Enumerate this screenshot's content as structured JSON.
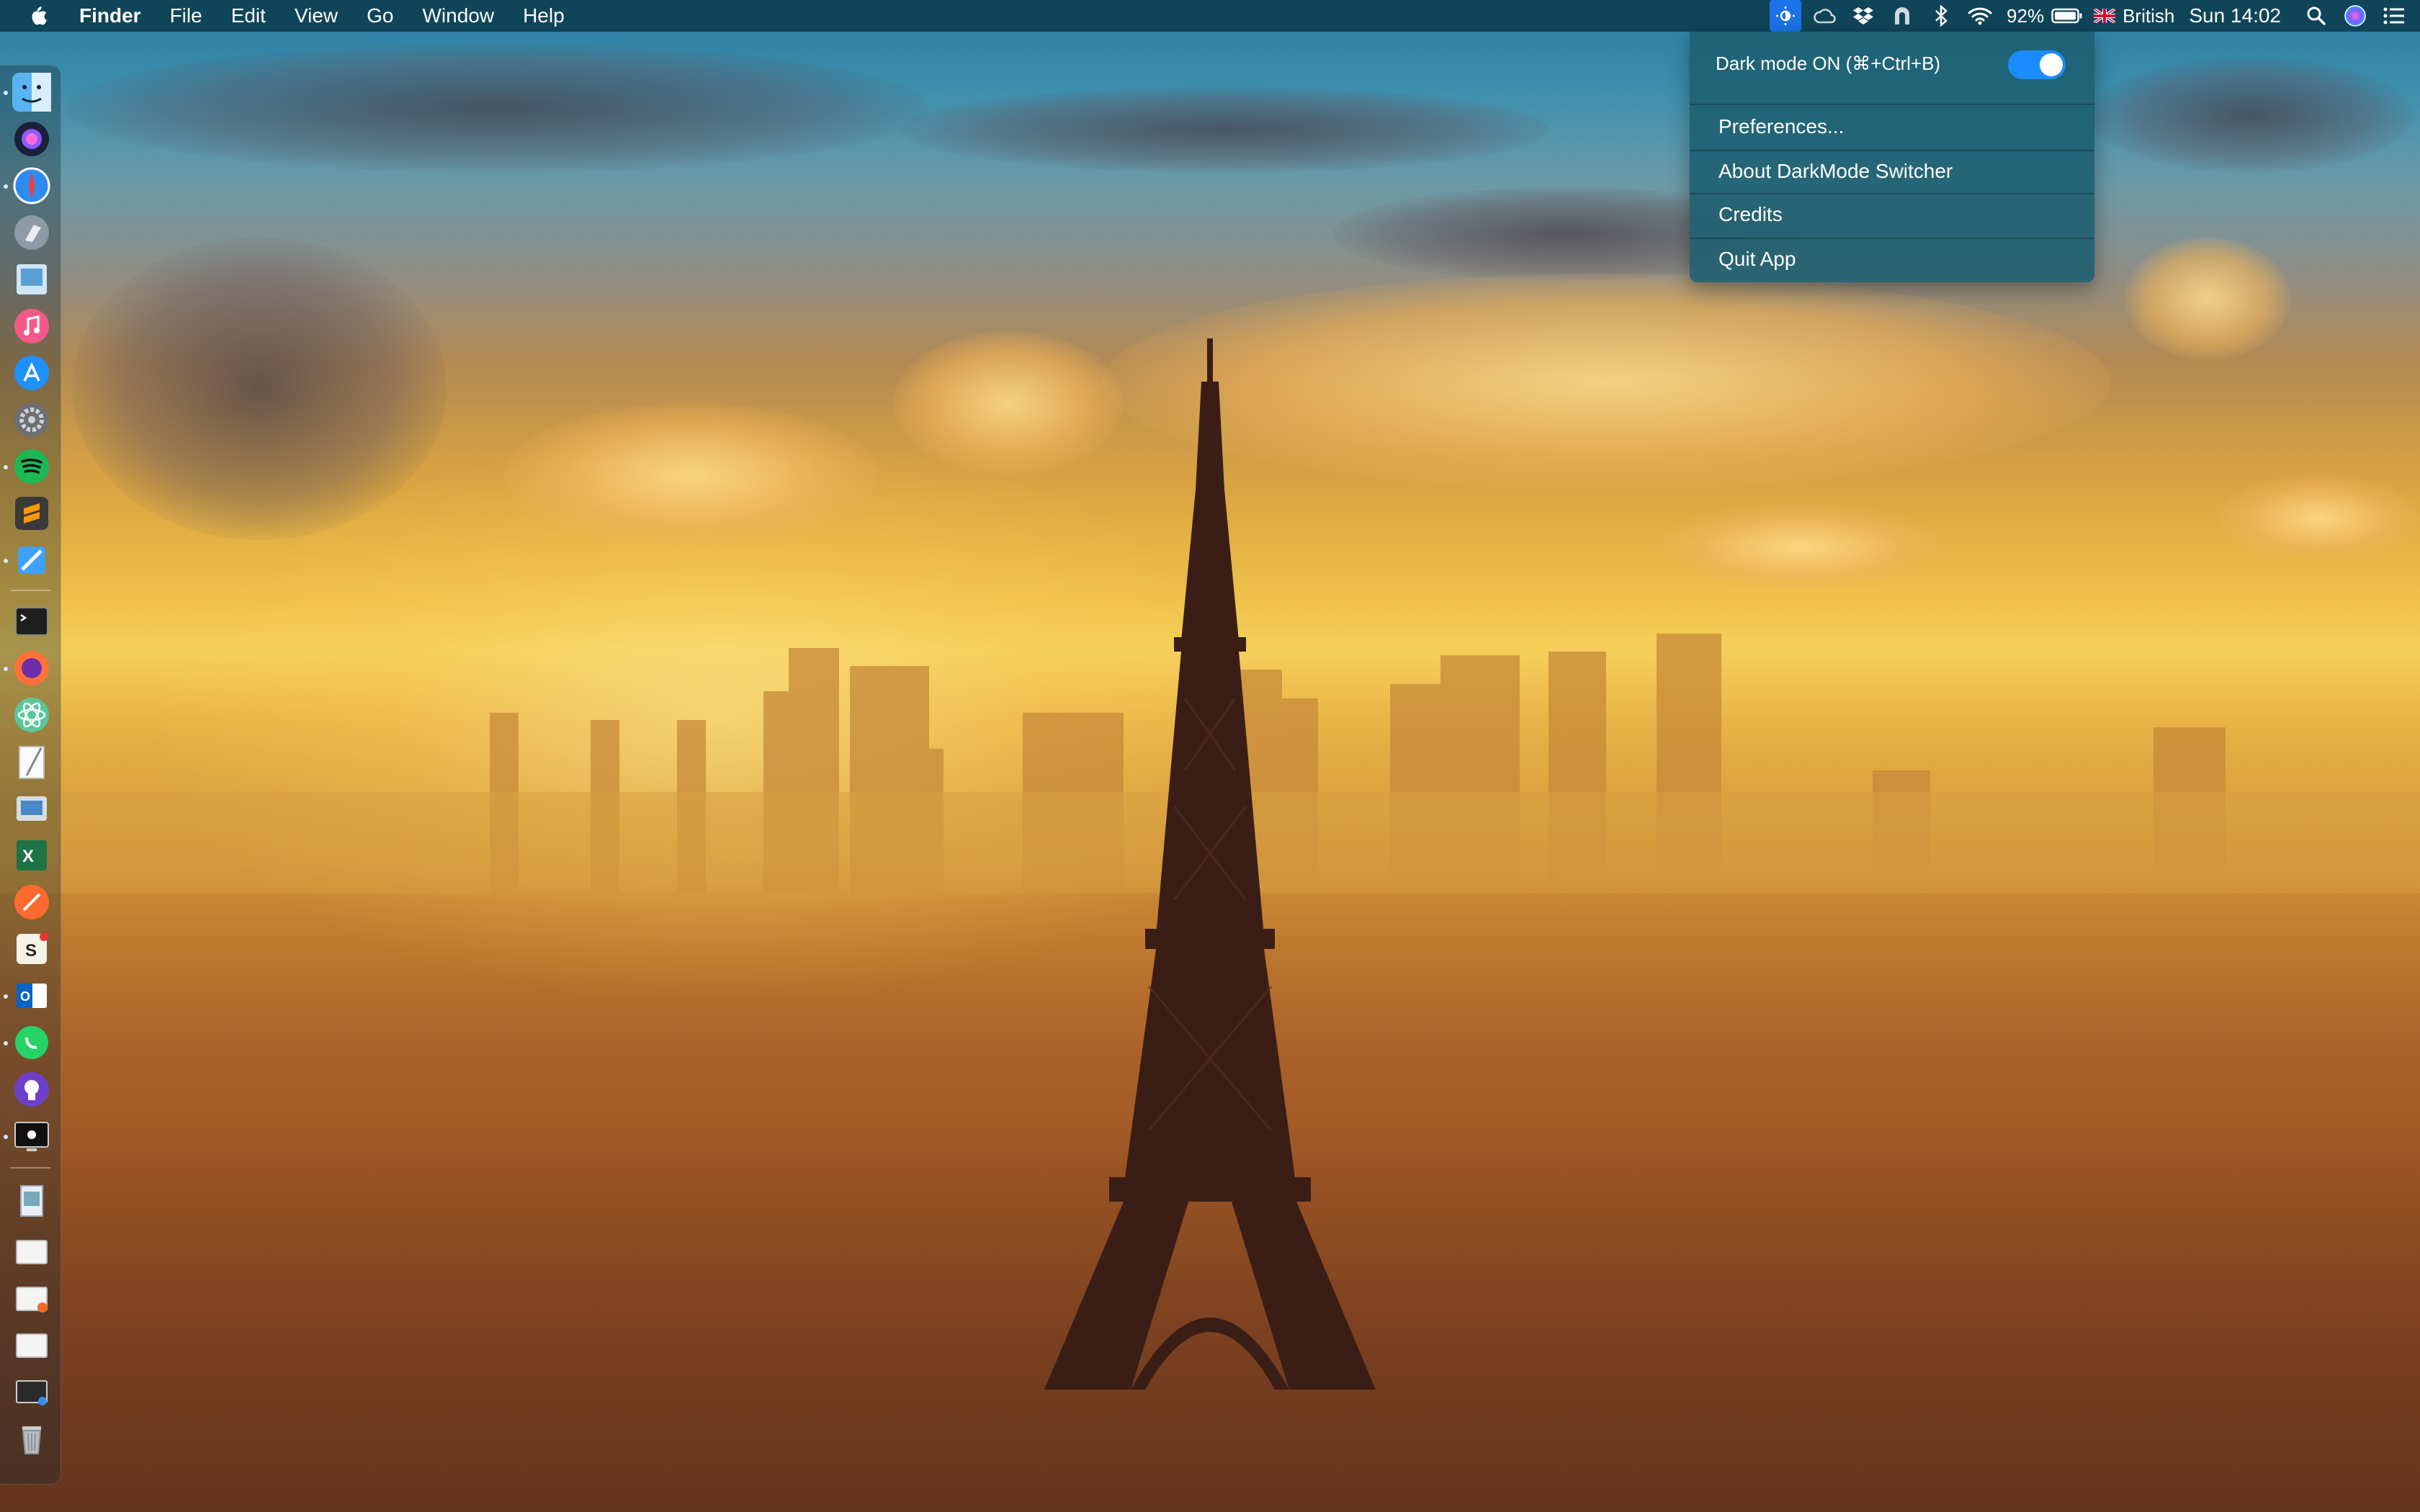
{
  "menubar": {
    "app_name": "Finder",
    "menus": [
      "File",
      "Edit",
      "View",
      "Go",
      "Window",
      "Help"
    ],
    "battery": "92%",
    "input_source": "British",
    "clock": "Sun 14:02",
    "status_icons": [
      "darkmode-switcher-icon",
      "creative-cloud-icon",
      "dropbox-icon",
      "backup-icon",
      "bluetooth-icon",
      "wifi-icon",
      "battery-icon",
      "uk-flag-icon",
      "spotlight-search-icon",
      "siri-icon",
      "notification-center-icon"
    ]
  },
  "dropdown": {
    "toggle_label": "Dark mode ON (⌘+Ctrl+B)",
    "toggle_on": true,
    "items": [
      "Preferences...",
      "About DarkMode Switcher",
      "Credits",
      "Quit App"
    ]
  },
  "dock": {
    "apps": [
      "finder-icon",
      "siri-icon",
      "safari-icon",
      "launchpad-icon",
      "preview-icon",
      "itunes-icon",
      "app-store-icon",
      "system-preferences-icon",
      "spotify-icon",
      "sublime-text-icon",
      "xcode-icon",
      "terminal-icon",
      "firefox-icon",
      "atom-icon",
      "textedit-icon",
      "image-capture-icon",
      "excel-icon",
      "paw-icon",
      "sketch-icon",
      "outlook-icon",
      "whatsapp-icon",
      "github-desktop-icon",
      "darkmode-app-icon",
      "document-icon",
      "folder-doc-icon",
      "note-icon",
      "window-icon",
      "desktop-icon",
      "trash-icon"
    ]
  },
  "colors": {
    "menubar_bg": "#0e4052",
    "dropdown_bg": "#1c5e70",
    "toggle_on": "#1a8cff",
    "highlight": "#1a73e8"
  }
}
